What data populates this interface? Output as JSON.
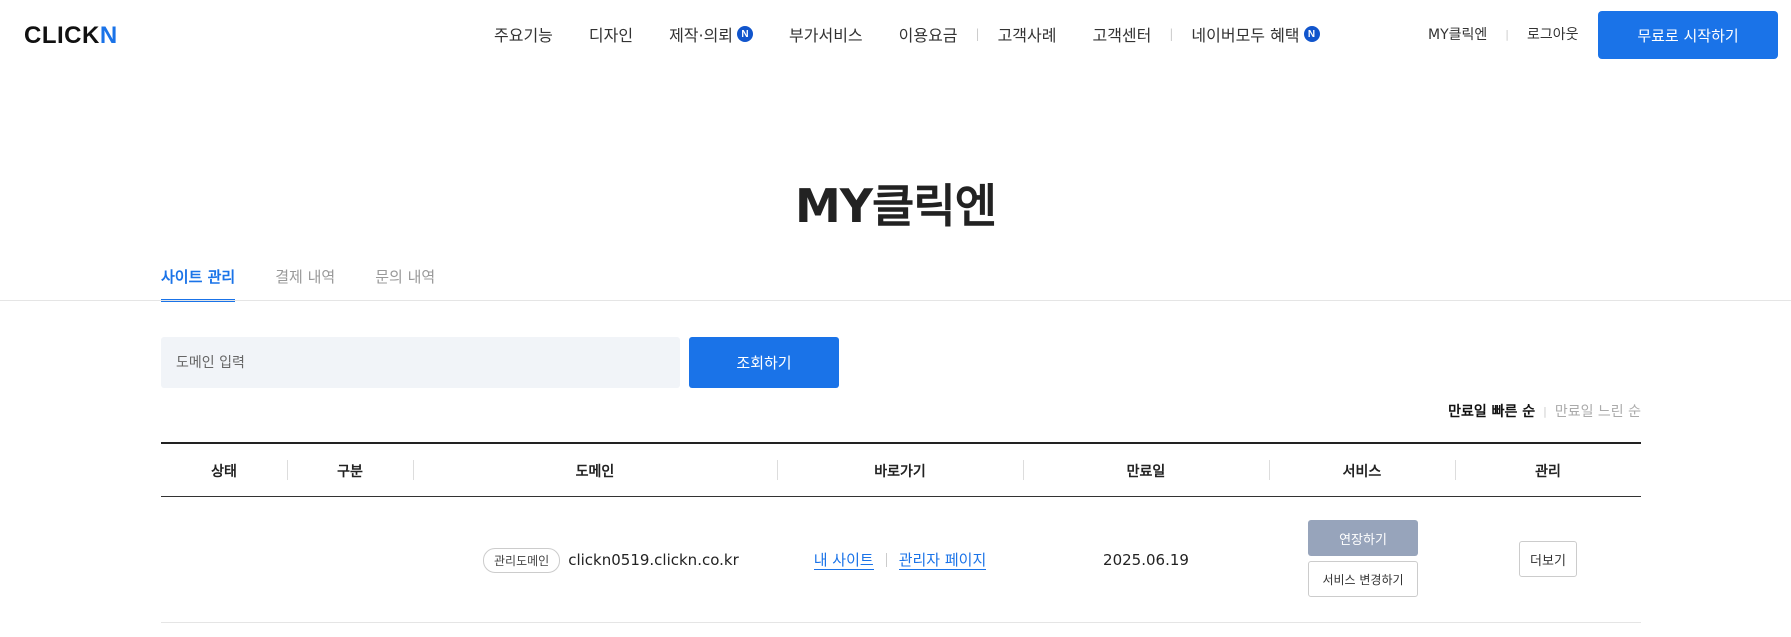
{
  "header": {
    "logo_main": "CLICK",
    "logo_accent": "N",
    "nav": [
      {
        "label": "주요기능"
      },
      {
        "label": "디자인"
      },
      {
        "label": "제작·의뢰",
        "badge": "N"
      },
      {
        "label": "부가서비스"
      },
      {
        "label": "이용요금"
      },
      {
        "label": "고객사례"
      },
      {
        "label": "고객센터"
      },
      {
        "label": "네이버모두 혜택",
        "badge": "N"
      }
    ],
    "my_link": "MY클릭엔",
    "logout": "로그아웃",
    "start_button": "무료로 시작하기"
  },
  "page": {
    "title": "MY클릭엔"
  },
  "tabs": [
    {
      "label": "사이트 관리",
      "active": true
    },
    {
      "label": "결제 내역"
    },
    {
      "label": "문의 내역"
    }
  ],
  "search": {
    "placeholder": "도메인 입력",
    "value": "",
    "button": "조회하기"
  },
  "sort": {
    "active": "만료일 빠른 순",
    "inactive": "만료일 느린 순"
  },
  "table": {
    "columns": [
      "상태",
      "구분",
      "도메인",
      "바로가기",
      "만료일",
      "서비스",
      "관리"
    ],
    "rows": [
      {
        "status": "",
        "category": "",
        "tag": "관리도메인",
        "domain": "clickn0519.clickn.co.kr",
        "link_site": "내 사이트",
        "link_admin": "관리자 페이지",
        "expiry": "2025.06.19",
        "renew": "연장하기",
        "change": "서비스 변경하기",
        "more": "더보기"
      }
    ]
  },
  "colors": {
    "accent": "#1a73e8",
    "renew_button": "#97a4bb",
    "search_bg": "#f1f4f8"
  }
}
